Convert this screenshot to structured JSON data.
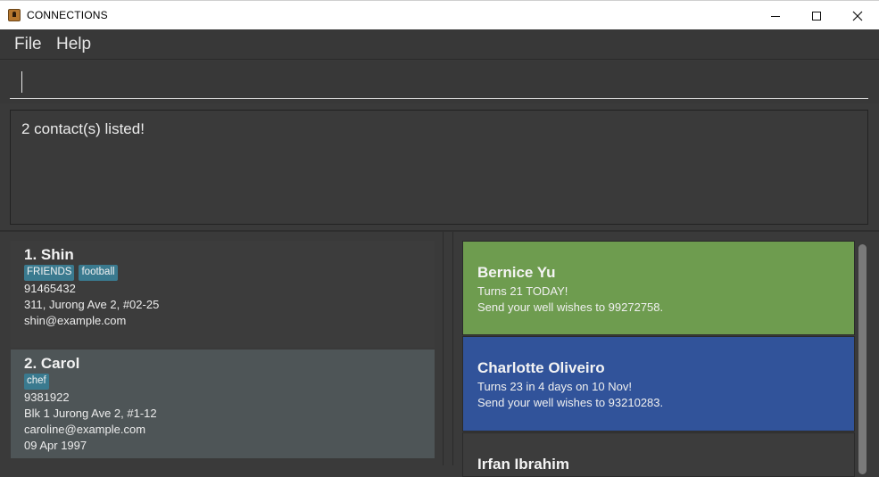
{
  "window": {
    "title": "CONNECTIONS"
  },
  "menu": {
    "file": "File",
    "help": "Help"
  },
  "command": {
    "value": ""
  },
  "result": {
    "message": "2 contact(s) listed!"
  },
  "persons": [
    {
      "index_name": "1.  Shin",
      "tags": [
        "FRIENDS",
        "football"
      ],
      "phone": "91465432",
      "address": "311, Jurong Ave 2, #02-25",
      "email": "shin@example.com"
    },
    {
      "index_name": "2.  Carol",
      "tags": [
        "chef"
      ],
      "phone": "9381922",
      "address": "Blk 1 Jurong Ave 2, #1-12",
      "email": "caroline@example.com",
      "birthday": "09 Apr 1997"
    }
  ],
  "birthdays": [
    {
      "name": "Bernice Yu",
      "line1": "Turns 21 TODAY!",
      "line2": "Send your well wishes to 99272758.",
      "color": "#6e9c4f"
    },
    {
      "name": "Charlotte Oliveiro",
      "line1": "Turns 23 in 4 days on 10 Nov!",
      "line2": "Send your well wishes to 93210283.",
      "color": "#31539a"
    },
    {
      "name": "Irfan Ibrahim"
    }
  ],
  "icons": {
    "app": "contacts-app-icon",
    "minimize": "minimize-icon",
    "maximize": "maximize-icon",
    "close": "close-icon"
  }
}
